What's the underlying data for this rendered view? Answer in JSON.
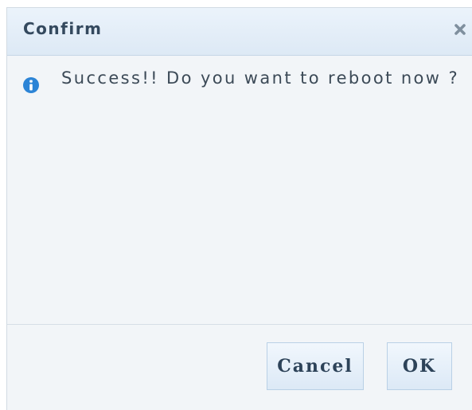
{
  "dialog": {
    "title": "Confirm",
    "close_icon": "close-icon",
    "info_icon": "info-icon",
    "message": "Success!! Do you want to reboot now ?",
    "buttons": {
      "cancel_label": "Cancel",
      "ok_label": "OK"
    }
  },
  "colors": {
    "titlebar_bg": "#dde9f5",
    "dialog_bg": "#f2f5f8",
    "info_icon": "#2c84d6",
    "text": "#3c4a57"
  }
}
